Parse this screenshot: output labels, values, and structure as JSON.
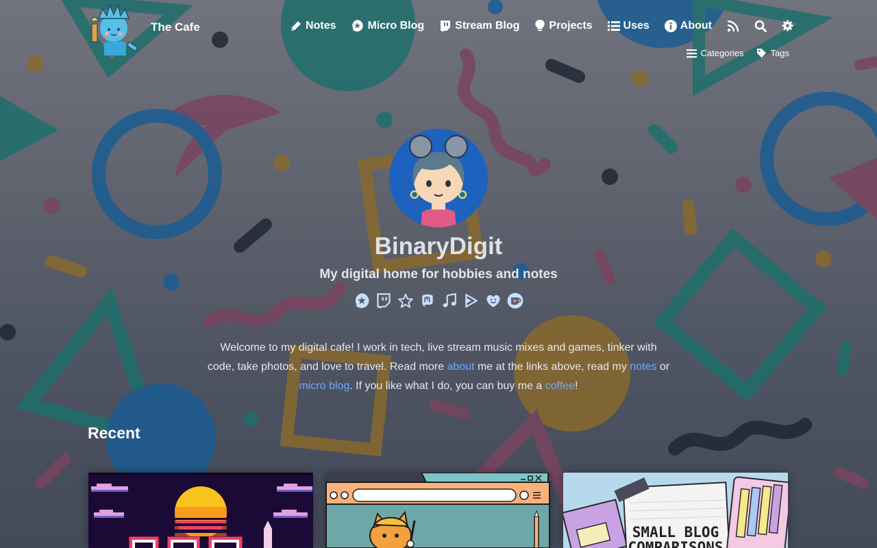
{
  "site": {
    "title": "The Cafe",
    "logo_icon": "statue-of-liberty-cartoon-icon"
  },
  "nav": {
    "items": [
      {
        "label": "Notes",
        "icon": "pencil-icon"
      },
      {
        "label": "Micro Blog",
        "icon": "star-bubble-icon"
      },
      {
        "label": "Stream Blog",
        "icon": "twitch-icon"
      },
      {
        "label": "Projects",
        "icon": "lightbulb-icon"
      },
      {
        "label": "Uses",
        "icon": "list-icon"
      },
      {
        "label": "About",
        "icon": "info-icon"
      }
    ],
    "rss_icon": "rss-icon",
    "search_icon": "search-icon",
    "settings_icon": "gear-icon"
  },
  "subnav": {
    "categories": "Categories",
    "tags": "Tags"
  },
  "hero": {
    "name": "BinaryDigit",
    "tagline": "My digital home for hobbies and notes",
    "avatar_icon": "cartoon-avatar-girl-icon",
    "socials": [
      "star-bubble-icon",
      "twitch-icon",
      "star-icon",
      "mastodon-icon",
      "music-note-icon",
      "play-forward-icon",
      "smiley-heart-icon",
      "kofi-cup-icon"
    ]
  },
  "intro": {
    "part1": "Welcome to my digital cafe! I work in tech, live stream music mixes and games, tinker with code, take photos, and love to travel. Read more ",
    "about": "about",
    "part2": " me at the links above, read my ",
    "notes": "notes",
    "part3": " or ",
    "micro": "micro blog",
    "part4": ". If you like what I do, you can buy me a ",
    "coffee": "coffee",
    "part5": "!"
  },
  "recent": {
    "heading": "Recent",
    "cards": [
      {
        "art": "synthwave-pixel-sunset"
      },
      {
        "art": "retro-browser-cat"
      },
      {
        "art": "notebook-illustration",
        "text_line1": "SMALL BLOG",
        "text_line2": "COMPARISONS"
      }
    ]
  },
  "colors": {
    "link": "#6ea8ff",
    "teal_shape": "#1e6f6c",
    "blue_shape": "#1a5d93",
    "plum_shape": "#7a4460",
    "ochre_shape": "#8a6a2e"
  }
}
